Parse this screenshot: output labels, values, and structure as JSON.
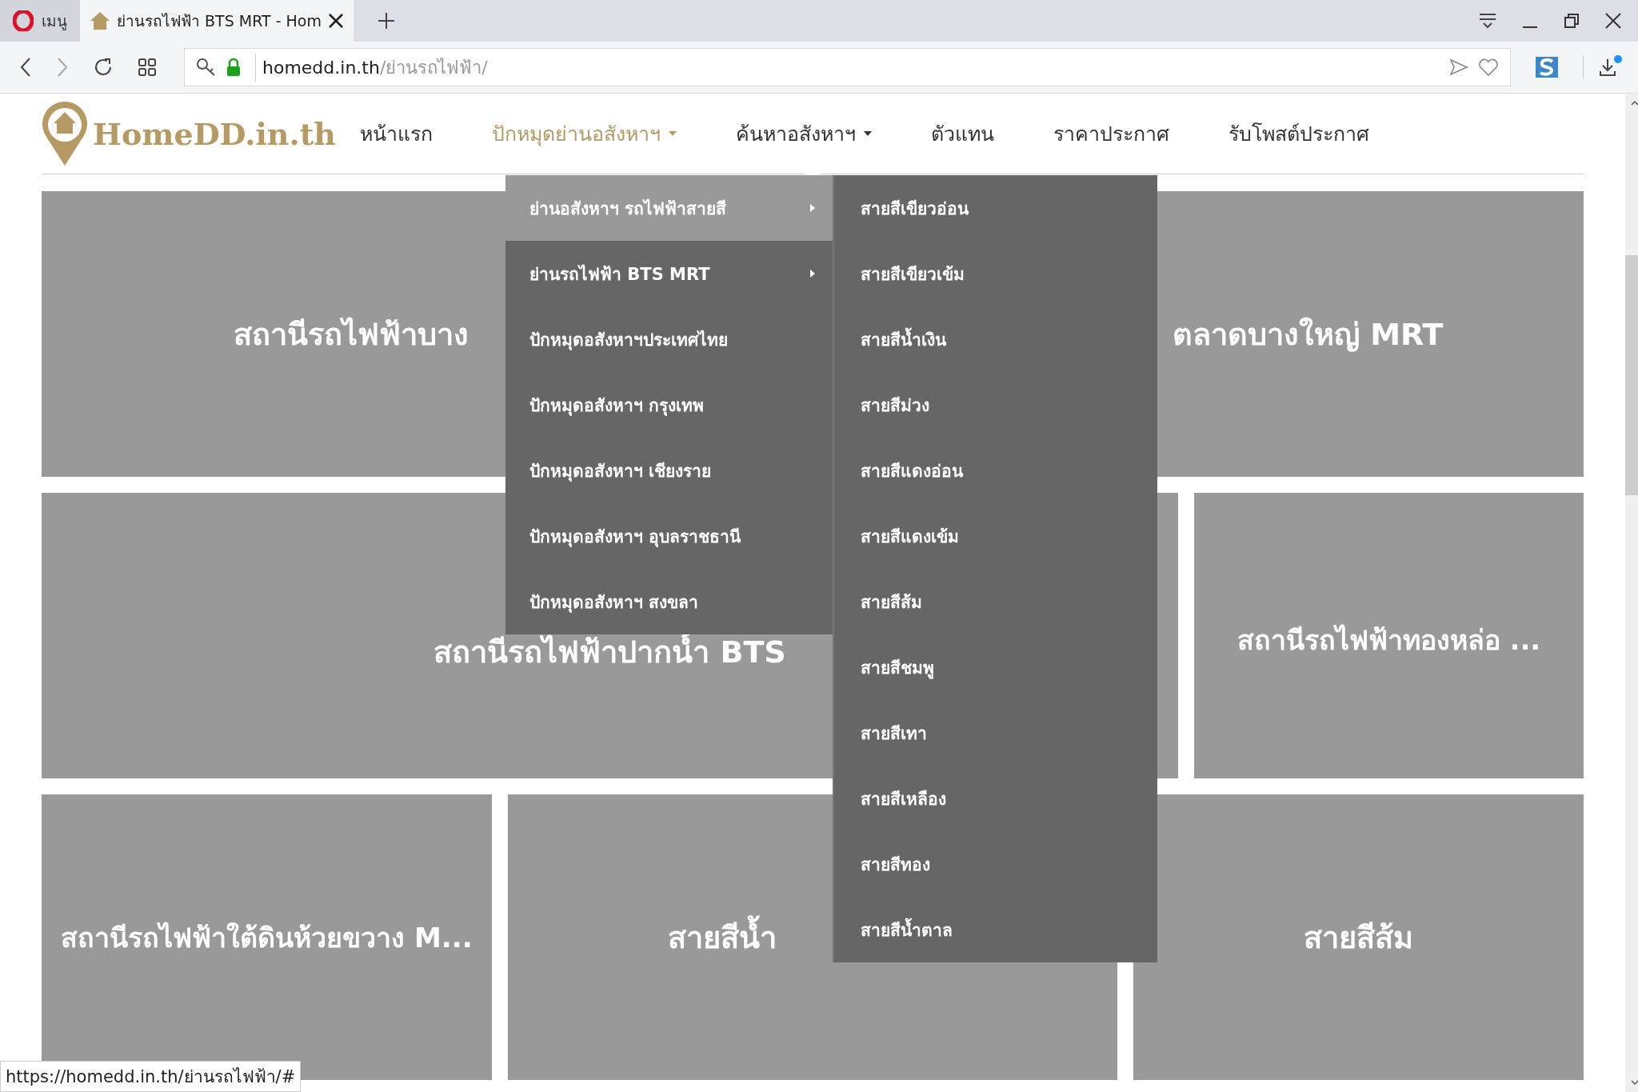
{
  "browser": {
    "menu_label": "เมนู",
    "tab": {
      "title": "ย่านรถไฟฟ้า BTS MRT - Hom",
      "selected": true
    },
    "url_host": "homedd.in.th",
    "url_path": "/ย่านรถไฟฟ้า/"
  },
  "logo": "HomeDD.in.th",
  "nav": [
    {
      "label": "หน้าแรก",
      "selected": false,
      "dropdown": false
    },
    {
      "label": "ปักหมุดย่านอสังหาฯ",
      "selected": true,
      "dropdown": true
    },
    {
      "label": "ค้นหาอสังหาฯ",
      "selected": false,
      "dropdown": true
    },
    {
      "label": "ตัวแทน",
      "selected": false,
      "dropdown": false
    },
    {
      "label": "ราคาประกาศ",
      "selected": false,
      "dropdown": false
    },
    {
      "label": "รับโพสต์ประกาศ",
      "selected": false,
      "dropdown": false
    }
  ],
  "dropdown": [
    {
      "label": "ย่านอสังหาฯ รถไฟฟ้าสายสี",
      "selected": true,
      "submenu": true
    },
    {
      "label": "ย่านรถไฟฟ้า BTS MRT",
      "selected": false,
      "submenu": true
    },
    {
      "label": "ปักหมุดอสังหาฯประเทศไทย",
      "selected": false,
      "submenu": false
    },
    {
      "label": "ปักหมุดอสังหาฯ กรุงเทพ",
      "selected": false,
      "submenu": false
    },
    {
      "label": "ปักหมุดอสังหาฯ เชียงราย",
      "selected": false,
      "submenu": false
    },
    {
      "label": "ปักหมุดอสังหาฯ อุบลราชธานี",
      "selected": false,
      "submenu": false
    },
    {
      "label": "ปักหมุดอสังหาฯ สงขลา",
      "selected": false,
      "submenu": false
    }
  ],
  "submenu": [
    "สายสีเขียวอ่อน",
    "สายสีเขียวเข้ม",
    "สายสีน้ำเงิน",
    "สายสีม่วง",
    "สายสีแดงอ่อน",
    "สายสีแดงเข้ม",
    "สายสีส้ม",
    "สายสีชมพู",
    "สายสีเทา",
    "สายสีเหลือง",
    "สายสีทอง",
    "สายสีน้ำตาล"
  ],
  "cards": [
    [
      {
        "title": "สถานีรถไฟฟ้าบาง"
      },
      {
        "title": "ตลาดบางใหญ่ MRT"
      }
    ],
    [
      {
        "title": "สถานีรถไฟฟ้าปากน้ำ BTS"
      },
      {
        "title": "สถานีรถไฟฟ้าทองหล่อ ..."
      }
    ],
    [
      {
        "title": "สถานีรถไฟฟ้าใต้ดินห้วยขวาง M..."
      },
      {
        "title": "สายสีน้ำ"
      },
      {
        "title": "สายสีส้ม"
      }
    ]
  ],
  "status_url": "https://homedd.in.th/ย่านรถไฟฟ้า/#"
}
